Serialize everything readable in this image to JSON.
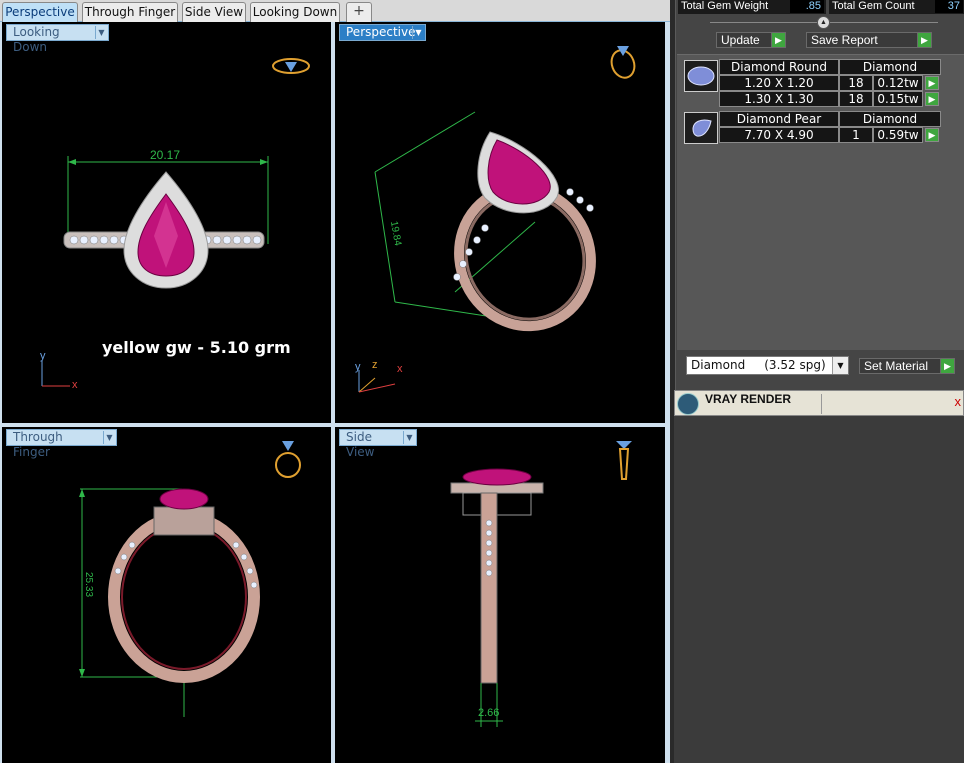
{
  "tabs": [
    {
      "label": "Perspective",
      "active": true
    },
    {
      "label": "Through Finger",
      "active": false
    },
    {
      "label": "Side View",
      "active": false
    },
    {
      "label": "Looking Down",
      "active": false
    }
  ],
  "tab_add_label": "+",
  "viewports": {
    "top_left": {
      "label": "Looking Down",
      "dimension": "20.17",
      "note": "yellow gw - 5.10 grm",
      "axes": {
        "y": "y",
        "x": "x"
      }
    },
    "top_right": {
      "label": "Perspective",
      "dimension": "19.84",
      "axes": {
        "y": "y",
        "z": "z",
        "x": "x"
      }
    },
    "bottom_left": {
      "label": "Through Finger",
      "dimension": "25.33"
    },
    "bottom_right": {
      "label": "Side View",
      "dimension": "2.66"
    }
  },
  "stats": {
    "gem_weight_label": "Total Gem Weight",
    "gem_weight_value": ".85",
    "gem_count_label": "Total Gem Count",
    "gem_count_value": "37"
  },
  "buttons": {
    "update": "Update",
    "save_report": "Save Report",
    "set_material": "Set Material"
  },
  "gems": [
    {
      "name": "Diamond Round",
      "material": "Diamond",
      "rows": [
        {
          "size": "1.20 X 1.20",
          "count": "18",
          "weight": "0.12tw"
        },
        {
          "size": "1.30 X 1.30",
          "count": "18",
          "weight": "0.15tw"
        }
      ]
    },
    {
      "name": "Diamond Pear",
      "material": "Diamond",
      "rows": [
        {
          "size": "7.70 X 4.90",
          "count": "1",
          "weight": "0.59tw"
        }
      ]
    }
  ],
  "material_select": {
    "value": "Diamond     (3.52 spg)"
  },
  "vray": {
    "title": "VRAY RENDER",
    "close": "x"
  },
  "colors": {
    "accent_tab": "#bfe0f7",
    "go_green": "#3fa63f",
    "dimension_green": "#2fb84a",
    "ruby": "#c0127a",
    "rose_gold": "#d8b0a6"
  }
}
